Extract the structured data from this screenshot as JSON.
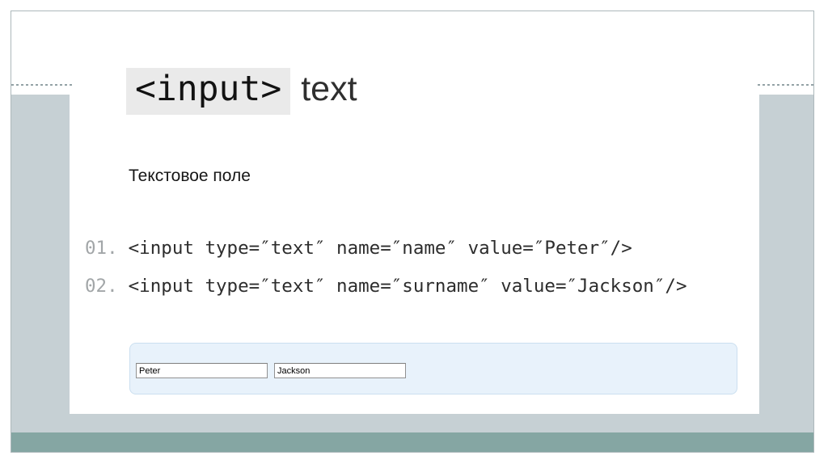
{
  "slide": {
    "title": {
      "code_tag": "<input>",
      "suffix": "text"
    },
    "subtitle": "Текстовое поле",
    "code_lines": [
      {
        "number": "01.",
        "code": "<input type=″text″ name=″name″ value=″Peter″/>"
      },
      {
        "number": "02.",
        "code": "<input type=″text″ name=″surname″ value=″Jackson″/>"
      }
    ],
    "demo": {
      "inputs": [
        {
          "name": "name",
          "value": "Peter"
        },
        {
          "name": "surname",
          "value": "Jackson"
        }
      ]
    },
    "colors": {
      "sidebar_gray": "#c6d0d4",
      "accent_teal": "#85a6a3",
      "frame_border": "#adb8bb",
      "title_chip_bg": "#eaeaea",
      "line_number_gray": "#a2a6a8",
      "demo_bg": "#e8f2fb",
      "demo_border": "#cbdff0"
    }
  }
}
